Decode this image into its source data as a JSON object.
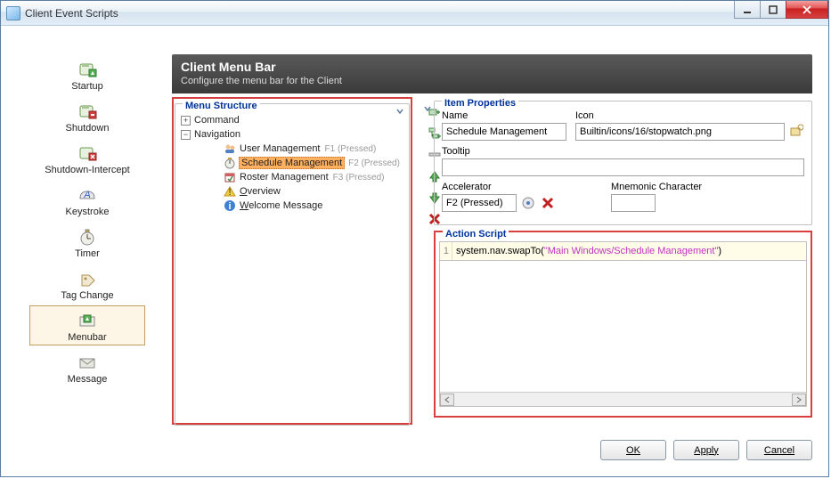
{
  "window": {
    "title": "Client Event Scripts"
  },
  "titlebar_buttons": {
    "minimize": "minimize",
    "maximize": "maximize",
    "close": "close"
  },
  "sidebar": {
    "items": [
      {
        "id": "startup",
        "label": "Startup"
      },
      {
        "id": "shutdown",
        "label": "Shutdown"
      },
      {
        "id": "shutdown-intercept",
        "label": "Shutdown-Intercept"
      },
      {
        "id": "keystroke",
        "label": "Keystroke"
      },
      {
        "id": "timer",
        "label": "Timer"
      },
      {
        "id": "tag-change",
        "label": "Tag Change"
      },
      {
        "id": "menubar",
        "label": "Menubar"
      },
      {
        "id": "message",
        "label": "Message"
      }
    ],
    "selected": "menubar"
  },
  "header": {
    "title": "Client Menu Bar",
    "subtitle": "Configure the menu bar for the Client"
  },
  "menu_structure": {
    "legend": "Menu Structure",
    "tree": [
      {
        "label": "Command",
        "expandable": true,
        "expanded": false
      },
      {
        "label": "Navigation",
        "expandable": true,
        "expanded": true,
        "children": [
          {
            "icon": "users",
            "label": "User Management",
            "hint": "F1 (Pressed)"
          },
          {
            "icon": "stopwatch",
            "label": "Schedule Management",
            "hint": "F2 (Pressed)",
            "selected": true
          },
          {
            "icon": "calendar",
            "label": "Roster Management",
            "hint": "F3 (Pressed)"
          },
          {
            "icon": "warning",
            "label": "Overview",
            "underline": "O"
          },
          {
            "icon": "info",
            "label": "Welcome Message",
            "underline": "W"
          }
        ]
      }
    ]
  },
  "tool_buttons": [
    "add-sibling",
    "add-child",
    "separator",
    "move-up",
    "move-down",
    "delete"
  ],
  "item_properties": {
    "legend": "Item Properties",
    "name_label": "Name",
    "name_value": "Schedule Management",
    "icon_label": "Icon",
    "icon_value": "Builtin/icons/16/stopwatch.png",
    "tooltip_label": "Tooltip",
    "tooltip_value": "",
    "accelerator_label": "Accelerator",
    "accelerator_value": "F2 (Pressed)",
    "mnemonic_label": "Mnemonic Character",
    "mnemonic_value": ""
  },
  "action_script": {
    "legend": "Action Script",
    "line_no": "1",
    "code_prefix": "system.nav.swapTo(",
    "code_string": "\"Main Windows/Schedule Management\"",
    "code_suffix": ")"
  },
  "footer": {
    "ok": "OK",
    "apply": "Apply",
    "cancel": "Cancel"
  }
}
